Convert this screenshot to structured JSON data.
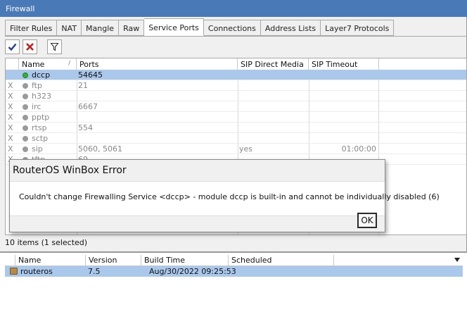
{
  "window": {
    "title": "Firewall"
  },
  "tabs": [
    {
      "label": "Filter Rules",
      "active": false
    },
    {
      "label": "NAT",
      "active": false
    },
    {
      "label": "Mangle",
      "active": false
    },
    {
      "label": "Raw",
      "active": false
    },
    {
      "label": "Service Ports",
      "active": true
    },
    {
      "label": "Connections",
      "active": false
    },
    {
      "label": "Address Lists",
      "active": false
    },
    {
      "label": "Layer7 Protocols",
      "active": false
    }
  ],
  "toolbar": {
    "enable_icon": "check-icon",
    "disable_icon": "x-icon",
    "filter_icon": "filter-icon"
  },
  "table": {
    "columns": [
      "Name",
      "Ports",
      "SIP Direct Media",
      "SIP Timeout"
    ],
    "rows": [
      {
        "flag": "",
        "name": "dccp",
        "ports": "54645",
        "sip_direct_media": "",
        "sip_timeout": "",
        "enabled": true,
        "selected": true
      },
      {
        "flag": "X",
        "name": "ftp",
        "ports": "21",
        "sip_direct_media": "",
        "sip_timeout": "",
        "enabled": false,
        "selected": false
      },
      {
        "flag": "X",
        "name": "h323",
        "ports": "",
        "sip_direct_media": "",
        "sip_timeout": "",
        "enabled": false,
        "selected": false
      },
      {
        "flag": "X",
        "name": "irc",
        "ports": "6667",
        "sip_direct_media": "",
        "sip_timeout": "",
        "enabled": false,
        "selected": false
      },
      {
        "flag": "X",
        "name": "pptp",
        "ports": "",
        "sip_direct_media": "",
        "sip_timeout": "",
        "enabled": false,
        "selected": false
      },
      {
        "flag": "X",
        "name": "rtsp",
        "ports": "554",
        "sip_direct_media": "",
        "sip_timeout": "",
        "enabled": false,
        "selected": false
      },
      {
        "flag": "X",
        "name": "sctp",
        "ports": "",
        "sip_direct_media": "",
        "sip_timeout": "",
        "enabled": false,
        "selected": false
      },
      {
        "flag": "X",
        "name": "sip",
        "ports": "5060, 5061",
        "sip_direct_media": "yes",
        "sip_timeout": "01:00:00",
        "enabled": false,
        "selected": false
      },
      {
        "flag": "X",
        "name": "tftp",
        "ports": "69",
        "sip_direct_media": "",
        "sip_timeout": "",
        "enabled": false,
        "selected": false
      }
    ]
  },
  "status": "10 items (1 selected)",
  "packages": {
    "columns": [
      "Name",
      "Version",
      "Build Time",
      "Scheduled"
    ],
    "rows": [
      {
        "name": "routeros",
        "version": "7.5",
        "build_time": "Aug/30/2022 09:25:53",
        "scheduled": ""
      }
    ]
  },
  "dialog": {
    "title": "RouterOS WinBox Error",
    "message": "Couldn't change Firewalling Service <dccp> - module dccp is built-in and cannot be individually disabled (6)",
    "ok_label": "OK"
  },
  "colors": {
    "titlebar": "#4a79b8",
    "selection": "#a9c8ec",
    "enabled_dot": "#38b038"
  }
}
